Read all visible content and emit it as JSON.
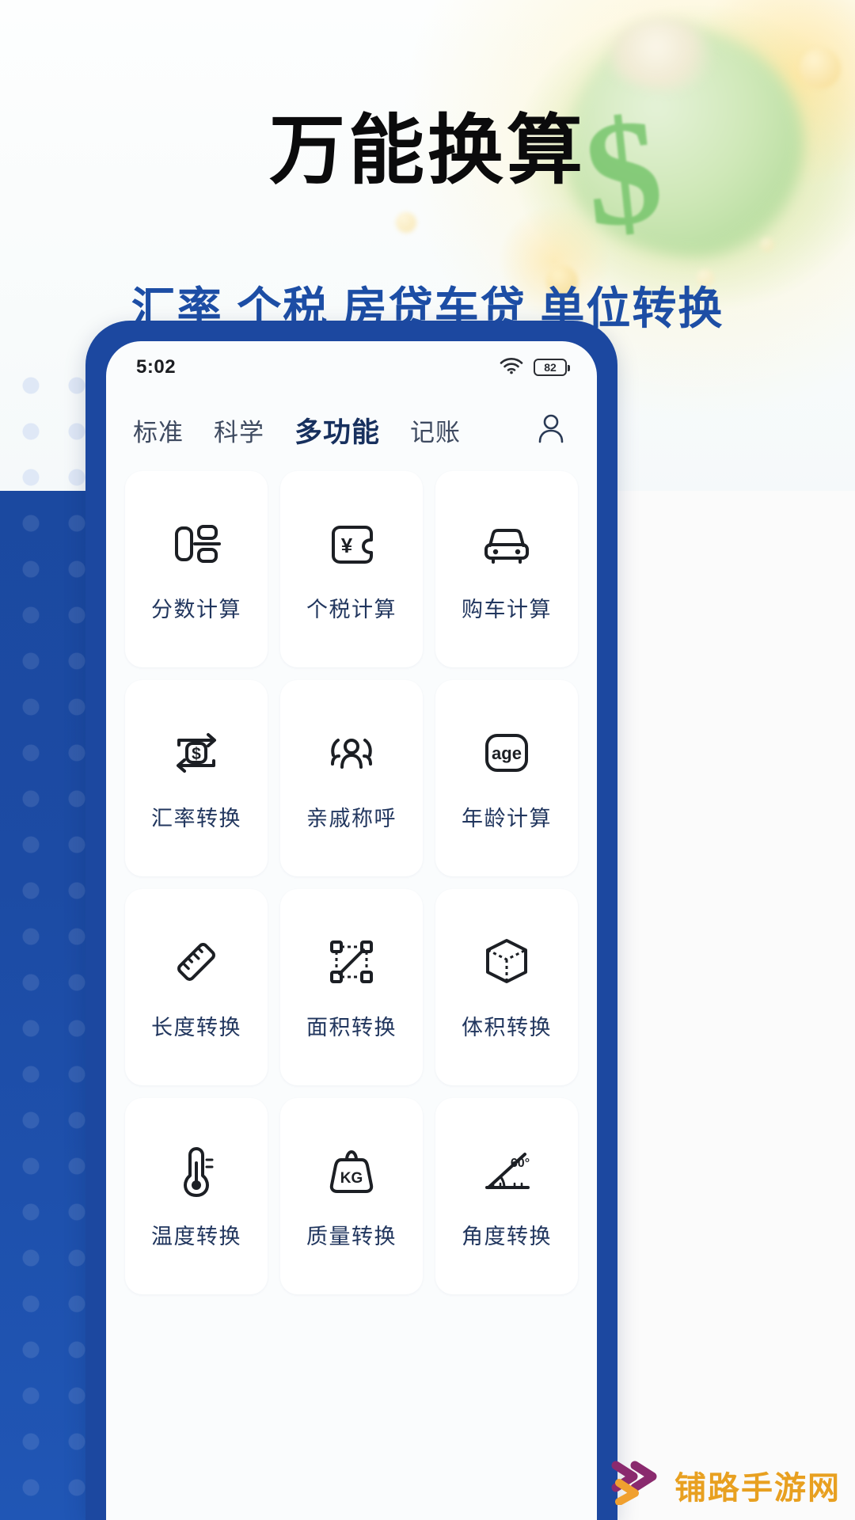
{
  "promo": {
    "title": "万能换算",
    "subtitle": "汇率 个税 房贷车贷 单位转换",
    "title_color": "#0b0b0c",
    "subtitle_color": "#1d4ea5",
    "accent_blue": "#1c48a0"
  },
  "phone": {
    "status": {
      "time": "5:02",
      "wifi_icon": "wifi-icon",
      "battery_icon": "battery-icon",
      "battery_level": "82"
    },
    "tabs": [
      {
        "label": "标准",
        "active": false
      },
      {
        "label": "科学",
        "active": false
      },
      {
        "label": "多功能",
        "active": true
      },
      {
        "label": "记账",
        "active": false
      }
    ],
    "profile_icon": "person-icon",
    "grid": [
      {
        "label": "分数计算",
        "icon": "fraction-icon"
      },
      {
        "label": "个税计算",
        "icon": "wallet-yuan-icon"
      },
      {
        "label": "购车计算",
        "icon": "car-icon"
      },
      {
        "label": "汇率转换",
        "icon": "exchange-dollar-icon"
      },
      {
        "label": "亲戚称呼",
        "icon": "family-icon"
      },
      {
        "label": "年龄计算",
        "icon": "age-icon"
      },
      {
        "label": "长度转换",
        "icon": "ruler-icon"
      },
      {
        "label": "面积转换",
        "icon": "area-icon"
      },
      {
        "label": "体积转换",
        "icon": "cube-icon"
      },
      {
        "label": "温度转换",
        "icon": "thermometer-icon"
      },
      {
        "label": "质量转换",
        "icon": "weight-kg-icon"
      },
      {
        "label": "角度转换",
        "icon": "angle-60-icon"
      }
    ]
  },
  "watermark": {
    "text": "铺路手游网",
    "logo_icon": "double-chevron-icon",
    "color_primary": "#8a2a6e",
    "color_secondary": "#f0a030",
    "text_color": "#e8a020"
  }
}
